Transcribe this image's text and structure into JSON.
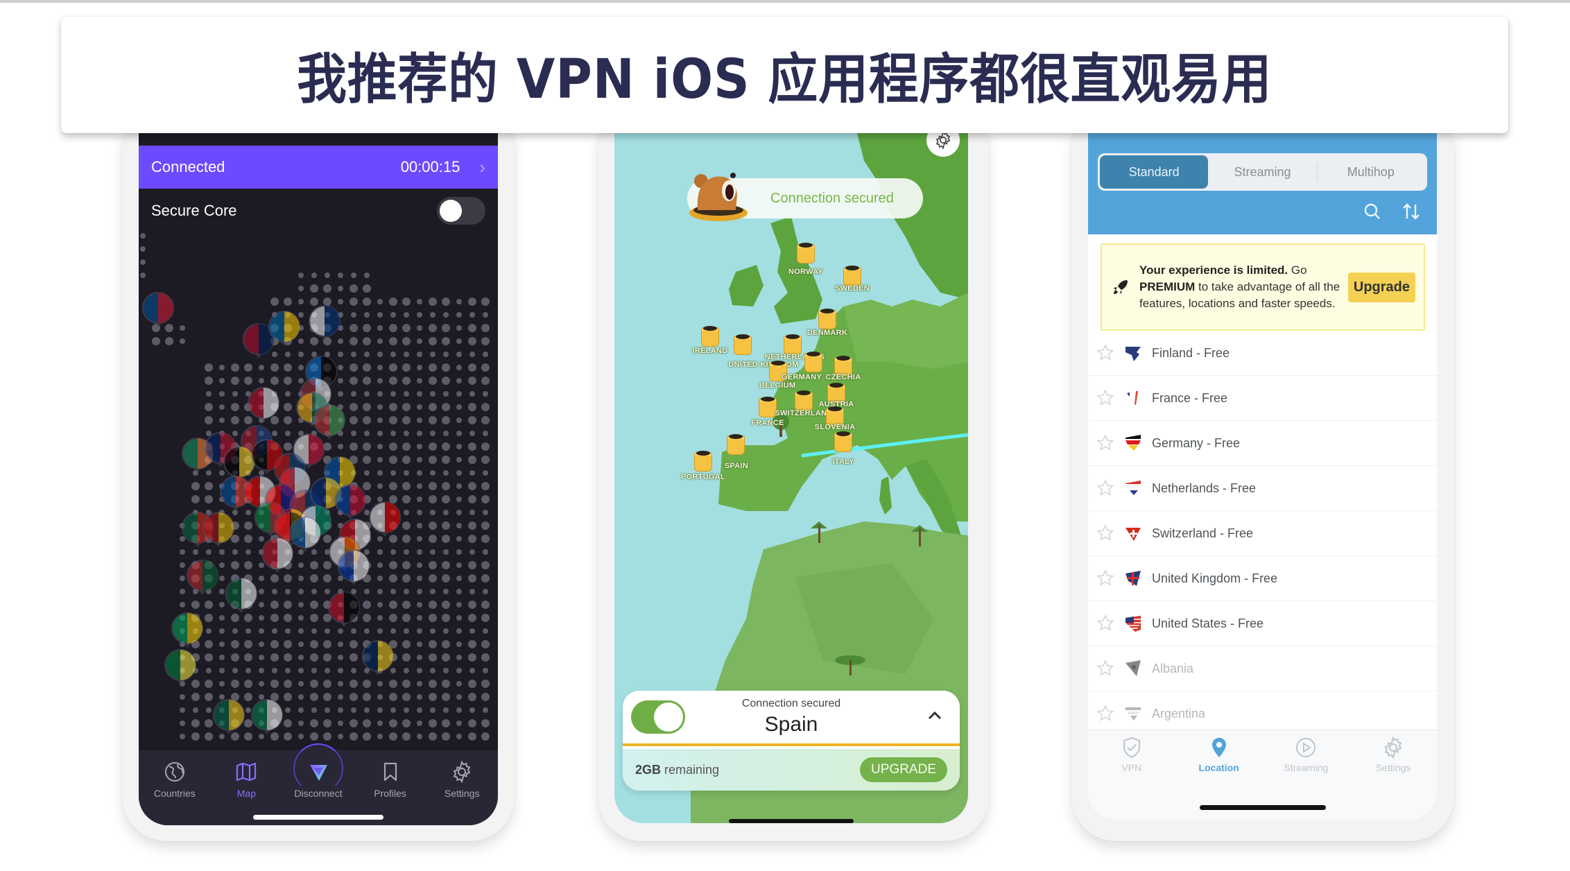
{
  "page": {
    "title": "我推荐的 VPN iOS 应用程序都很直观易用"
  },
  "colors": {
    "title_text": "#2a2c52",
    "proton_accent": "#6d4aff",
    "proton_bg": "#1c1b24",
    "tunnelbear_green": "#76b24c",
    "tunnelbear_sea": "#a3dfe1",
    "tunnelbear_gold": "#f0b323",
    "hideme_blue": "#54a4dc",
    "hideme_upgrade": "#f4d152"
  },
  "phone1": {
    "status_label": "Connected",
    "timer": "00:00:15",
    "secure_core_label": "Secure Core",
    "secure_core_enabled": false,
    "tabs": [
      {
        "label": "Countries",
        "icon": "globe-icon",
        "active": false
      },
      {
        "label": "Map",
        "icon": "map-icon",
        "active": true
      },
      {
        "label": "Disconnect",
        "icon": "proton-logo-icon",
        "active": false
      },
      {
        "label": "Profiles",
        "icon": "bookmark-icon",
        "active": false
      },
      {
        "label": "Settings",
        "icon": "gear-icon",
        "active": false
      }
    ],
    "map_flags": [
      "Iceland",
      "Norway",
      "Sweden",
      "Finland",
      "Estonia",
      "Latvia",
      "Lithuania",
      "Belarus",
      "Denmark",
      "Ireland",
      "United Kingdom",
      "Netherlands",
      "Belgium",
      "Germany",
      "Poland",
      "Czechia",
      "Ukraine",
      "France",
      "Switzerland",
      "Austria",
      "Croatia",
      "Serbia",
      "Romania",
      "Moldova",
      "Italy",
      "North Macedonia",
      "Bulgaria",
      "Albania",
      "Greece",
      "Turkey",
      "Georgia",
      "Cyprus",
      "Israel",
      "Portugal",
      "Spain",
      "Morocco",
      "Algeria",
      "Malta",
      "Egypt",
      "Mauritania",
      "Senegal",
      "Mali",
      "Chad",
      "Nigeria"
    ]
  },
  "phone2": {
    "banner": "Connection secured",
    "map_labels": [
      "NORWAY",
      "SWEDEN",
      "DENMARK",
      "IRELAND",
      "UNITED KINGDOM",
      "NETHERLANDS",
      "BELGIUM",
      "GERMANY",
      "CZECHIA",
      "AUSTRIA",
      "FRANCE",
      "SWITZERLAND",
      "SLOVENIA",
      "SPAIN",
      "PORTUGAL",
      "ITALY"
    ],
    "card": {
      "status": "Connection secured",
      "country": "Spain",
      "connected": true,
      "data_amount": "2GB",
      "data_suffix": " remaining",
      "upgrade_label": "UPGRADE"
    }
  },
  "phone3": {
    "segments": [
      {
        "label": "Standard",
        "active": true
      },
      {
        "label": "Streaming",
        "active": false
      },
      {
        "label": "Multihop",
        "active": false
      }
    ],
    "promo": {
      "bold_lead": "Your experience is limited.",
      "text_1": " Go ",
      "bold_mid": "PREMIUM",
      "text_2": " to take advantage of all the features, locations and faster speeds.",
      "button": "Upgrade"
    },
    "locations": [
      {
        "name": "Finland - Free",
        "flag": "finland",
        "enabled": true
      },
      {
        "name": "France - Free",
        "flag": "france",
        "enabled": true
      },
      {
        "name": "Germany - Free",
        "flag": "germany",
        "enabled": true
      },
      {
        "name": "Netherlands - Free",
        "flag": "netherlands",
        "enabled": true
      },
      {
        "name": "Switzerland - Free",
        "flag": "switzerland",
        "enabled": true
      },
      {
        "name": "United Kingdom - Free",
        "flag": "uk",
        "enabled": true
      },
      {
        "name": "United States - Free",
        "flag": "usa",
        "enabled": true
      },
      {
        "name": "Albania",
        "flag": "albania",
        "enabled": false
      },
      {
        "name": "Argentina",
        "flag": "argentina",
        "enabled": false
      }
    ],
    "tabs": [
      {
        "label": "VPN",
        "icon": "shield-check-icon",
        "active": false
      },
      {
        "label": "Location",
        "icon": "location-pin-icon",
        "active": true
      },
      {
        "label": "Streaming",
        "icon": "play-circle-icon",
        "active": false
      },
      {
        "label": "Settings",
        "icon": "gear-icon",
        "active": false
      }
    ]
  }
}
